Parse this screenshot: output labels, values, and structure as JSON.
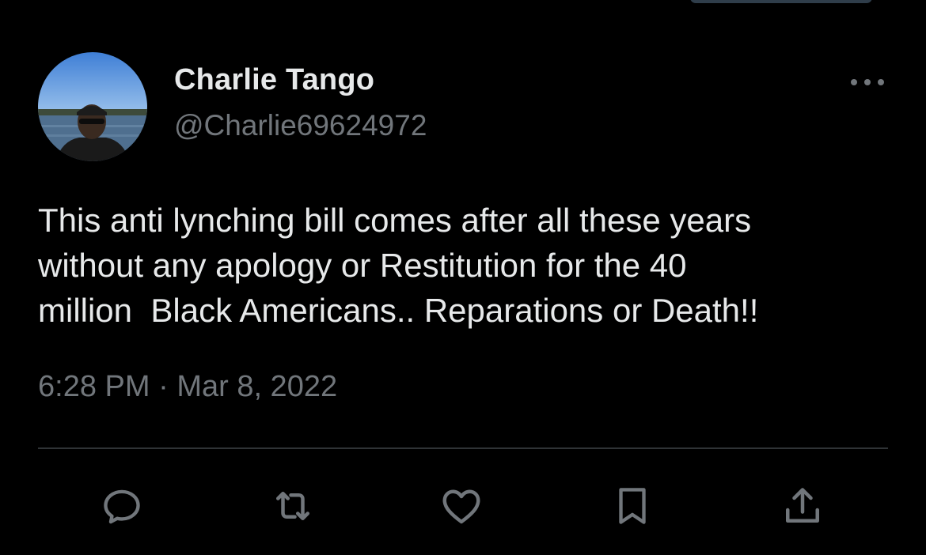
{
  "tweet": {
    "display_name": "Charlie Tango",
    "handle": "@Charlie69624972",
    "text": "This anti lynching bill comes after all these years\nwithout any apology or Restitution for the 40\nmillion  Black Americans.. Reparations or Death!!",
    "time": "6:28 PM",
    "separator": "·",
    "date": "Mar 8, 2022"
  },
  "icons": {
    "more": "more-horizontal-icon",
    "reply": "reply-icon",
    "retweet": "retweet-icon",
    "like": "heart-icon",
    "bookmark": "bookmark-icon",
    "share": "share-icon"
  },
  "colors": {
    "background": "#000000",
    "primary_text": "#e7e9ea",
    "secondary_text": "#71767b",
    "divider": "#2f3336"
  }
}
